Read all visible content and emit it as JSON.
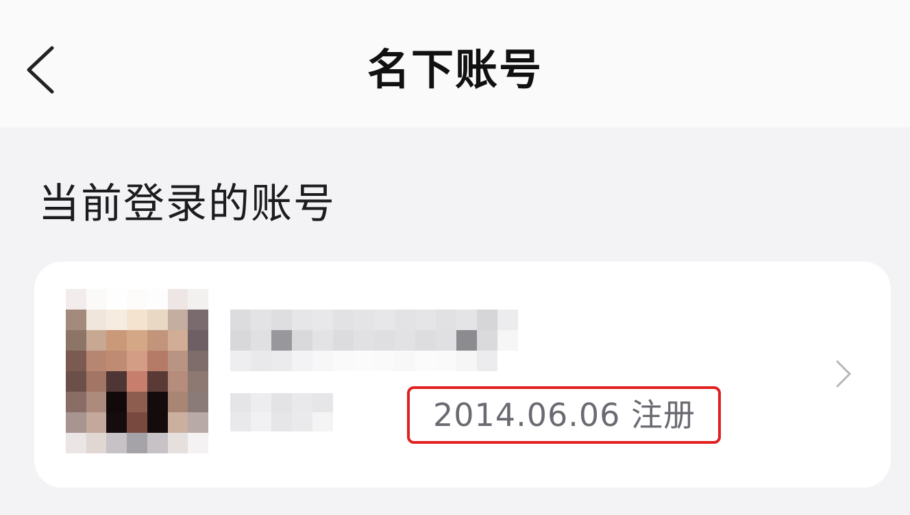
{
  "header": {
    "title": "名下账号",
    "back_icon": "chevron-left-icon"
  },
  "section": {
    "title": "当前登录的账号"
  },
  "account": {
    "registered_label": "2014.06.06 注册",
    "highlight_color": "#e02020",
    "open_icon": "chevron-right-icon"
  },
  "colors": {
    "background": "#f3f3f5",
    "nav_background": "#fafafb",
    "card_background": "#ffffff",
    "title_text": "#111111",
    "secondary_text": "#6a6a72"
  }
}
